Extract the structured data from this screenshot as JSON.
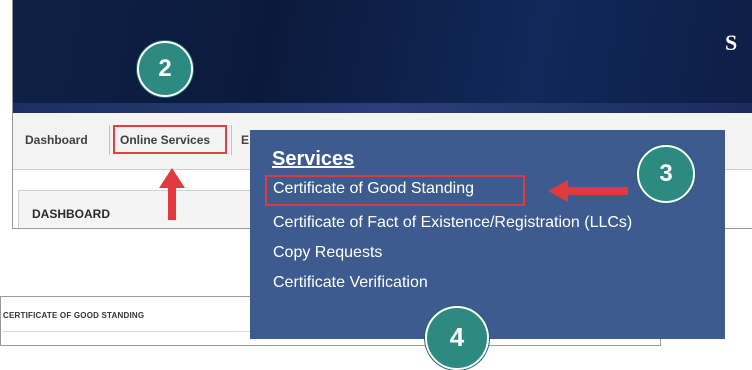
{
  "banner": {
    "site_fragment": "S"
  },
  "nav": {
    "items": [
      "Dashboard",
      "Online Services",
      "E"
    ],
    "highlighted_index": 1
  },
  "dashboard": {
    "title": "DASHBOARD"
  },
  "menu": {
    "heading": "Services",
    "items": [
      "Certificate of Good Standing",
      "Certificate of Fact of Existence/Registration (LLCs)",
      "Copy Requests",
      "Certificate Verification"
    ],
    "highlighted_index": 0
  },
  "badges": {
    "step2": "2",
    "step3": "3",
    "step4": "4"
  },
  "bottom_page": {
    "title": "CERTIFICATE OF GOOD STANDING"
  },
  "colors": {
    "banner": "#0f2046",
    "menu_bg": "#3e5b8f",
    "badge": "#2c8a80",
    "highlight_red": "#e04040",
    "arrow_red": "#e0393e"
  },
  "icons": [
    "up-arrow-icon",
    "left-arrow-icon"
  ]
}
